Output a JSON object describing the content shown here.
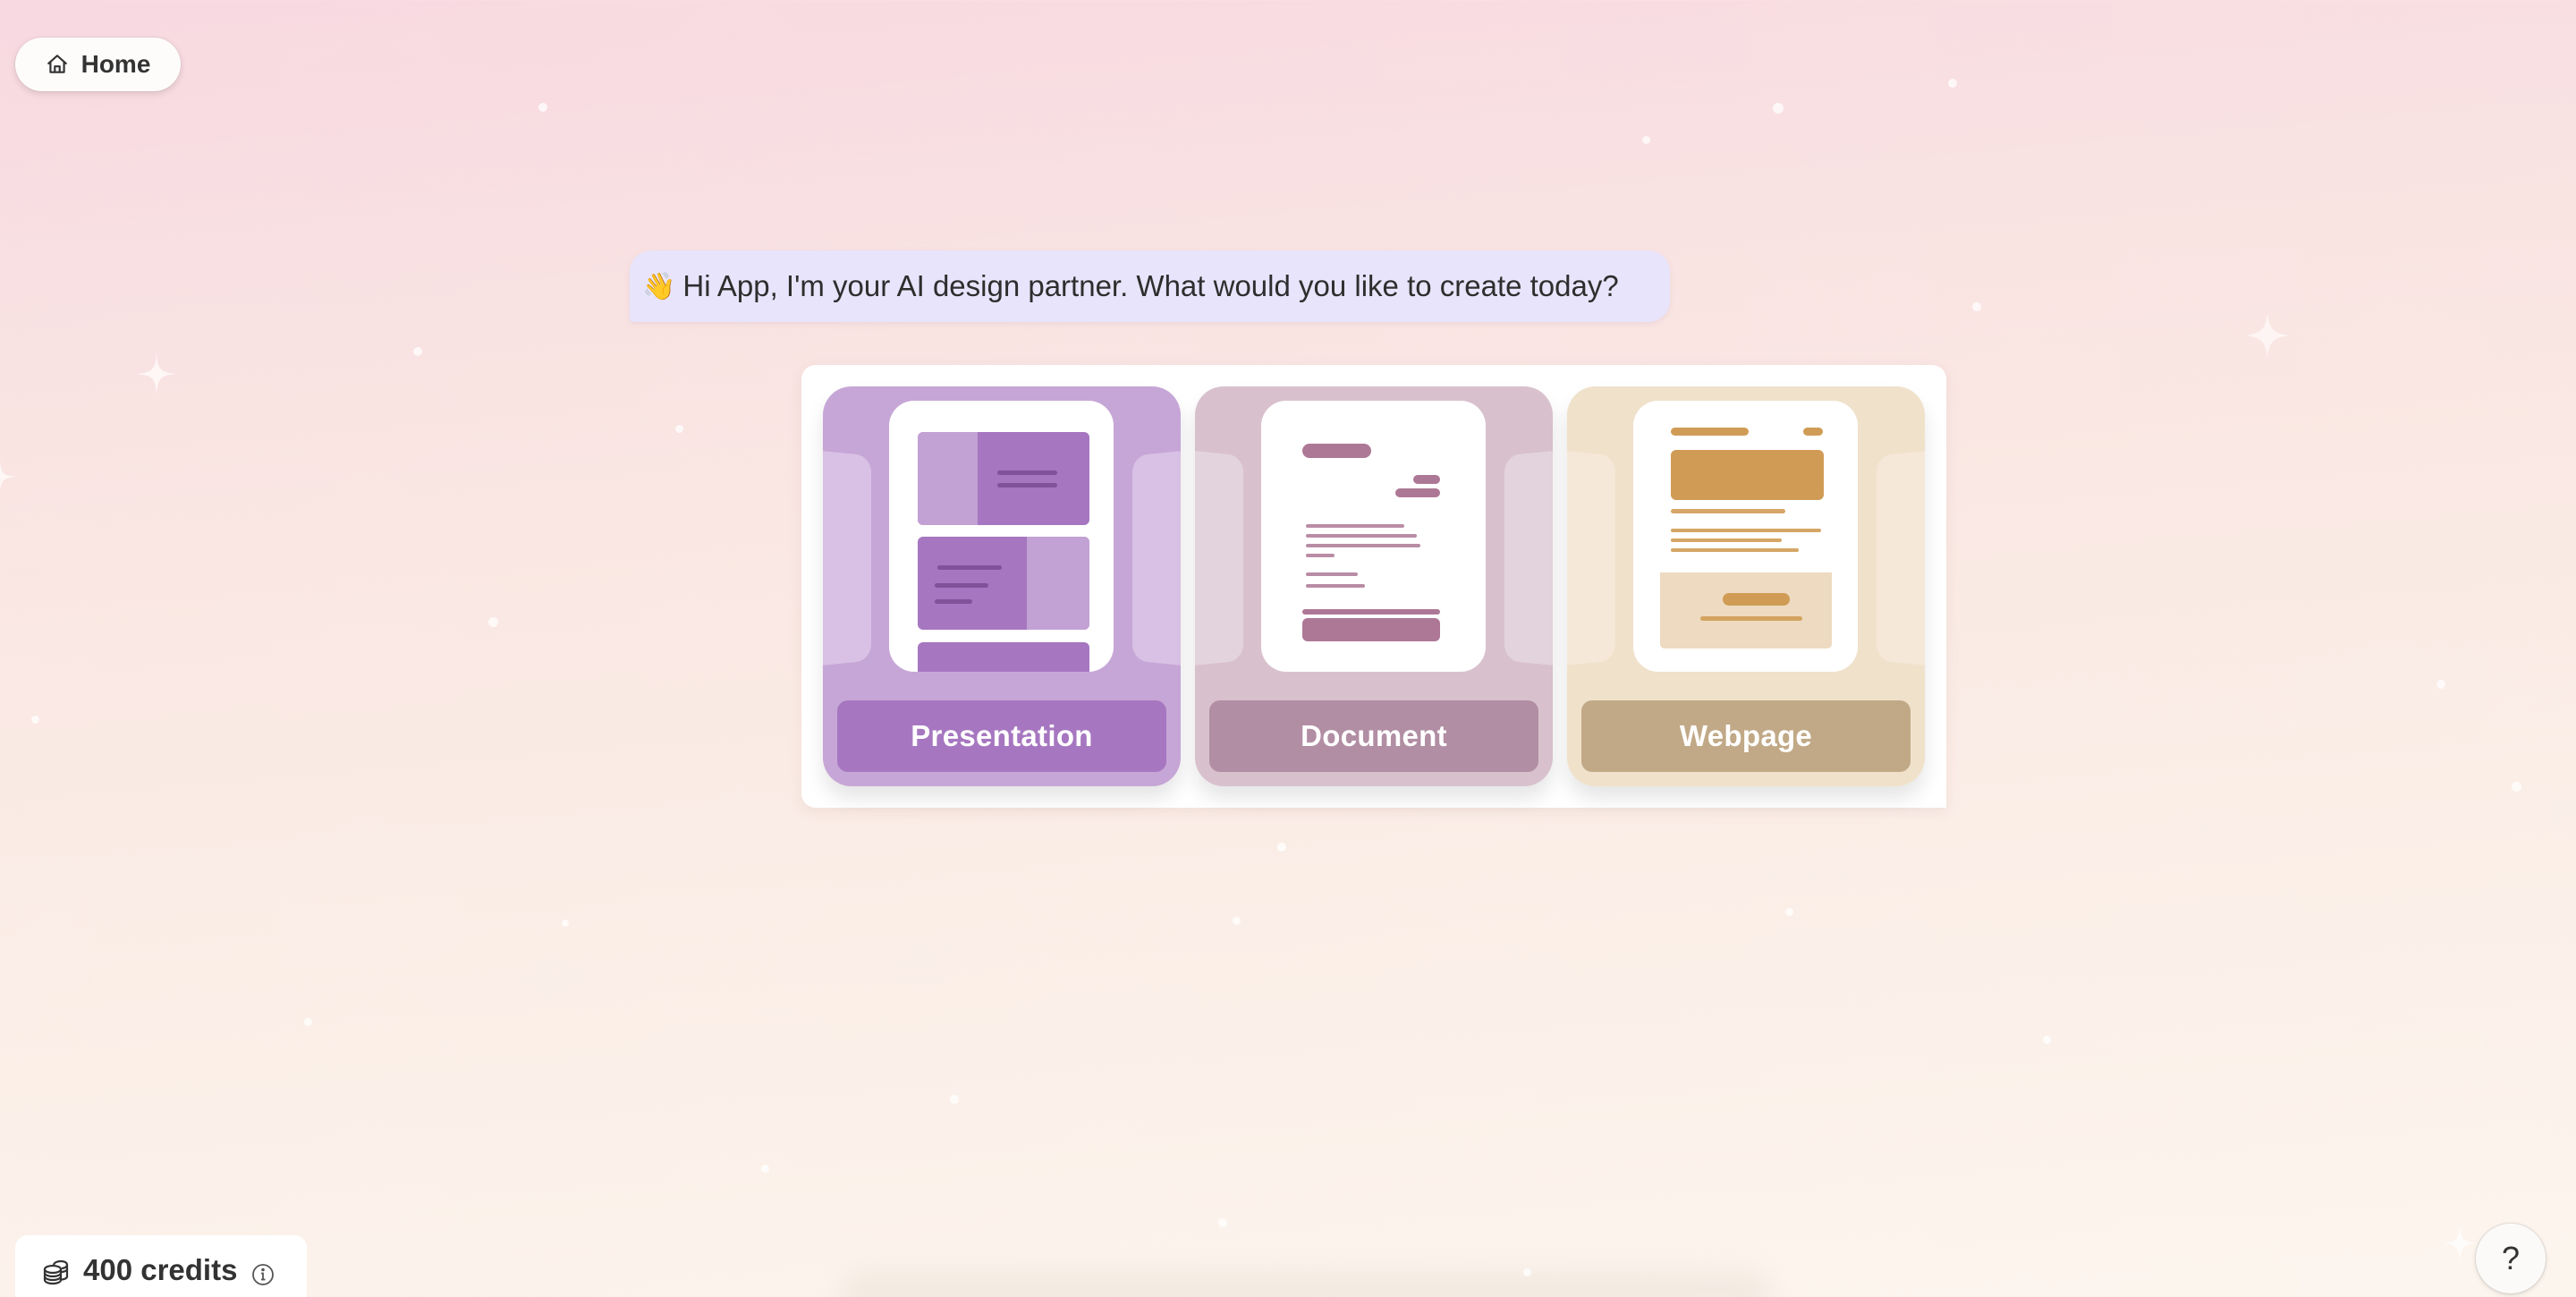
{
  "nav": {
    "home_label": "Home",
    "home_icon": "home-icon"
  },
  "greeting": {
    "emoji": "👋",
    "text": "Hi App, I'm your AI design partner. What would you like to create today?"
  },
  "create_options": [
    {
      "label": "Presentation",
      "icon": "presentation-thumbnail",
      "accent": "#A677C0",
      "background": "#C6A6D6"
    },
    {
      "label": "Document",
      "icon": "document-thumbnail",
      "accent": "#B18EA3",
      "background": "#D8C1CD"
    },
    {
      "label": "Webpage",
      "icon": "webpage-thumbnail",
      "accent": "#C1A987",
      "background": "#F0E1CB"
    }
  ],
  "credits": {
    "amount_label": "400 credits",
    "icon": "coins-icon",
    "info_icon": "info-icon"
  },
  "help": {
    "label": "?"
  },
  "colors": {
    "bubble": "#E8E4FB",
    "background_top": "#F8D8E1",
    "background_bottom": "#FCF5EE"
  }
}
